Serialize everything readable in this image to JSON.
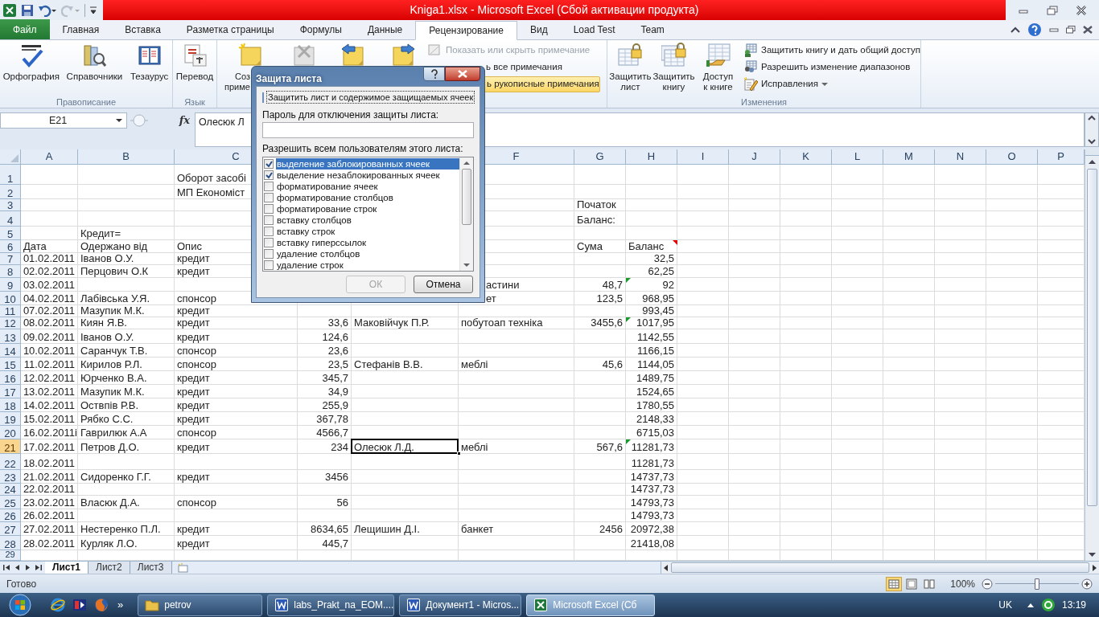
{
  "window": {
    "title": "Kniga1.xlsx  -  Microsoft Excel (Сбой активации продукта)"
  },
  "tabs": [
    {
      "label": "Файл",
      "kind": "file",
      "selected": false
    },
    {
      "label": "Главная",
      "kind": "tab",
      "selected": false
    },
    {
      "label": "Вставка",
      "kind": "tab",
      "selected": false
    },
    {
      "label": "Разметка страницы",
      "kind": "tab",
      "selected": false
    },
    {
      "label": "Формулы",
      "kind": "tab",
      "selected": false
    },
    {
      "label": "Данные",
      "kind": "tab",
      "selected": false
    },
    {
      "label": "Рецензирование",
      "kind": "tab",
      "selected": true
    },
    {
      "label": "Вид",
      "kind": "tab",
      "selected": false
    },
    {
      "label": "Load Test",
      "kind": "tab",
      "selected": false
    },
    {
      "label": "Team",
      "kind": "tab",
      "selected": false
    }
  ],
  "ribbon": {
    "groups": [
      {
        "label": "Правописание",
        "large": [
          {
            "label": "Орфография",
            "kind": "spell"
          },
          {
            "label": "Справочники",
            "kind": "research"
          },
          {
            "label": "Тезаурус",
            "kind": "thesaurus"
          }
        ]
      },
      {
        "label": "Язык",
        "large": [
          {
            "label": "Перевод",
            "kind": "translate"
          }
        ]
      },
      {
        "notes": [
          {
            "label_lines": [
              "Соз",
              "приме"
            ],
            "kind": "new-note"
          },
          {
            "kind": "delete-note"
          },
          {
            "kind": "prev-note"
          },
          {
            "kind": "next-note"
          }
        ],
        "small": [
          {
            "label": "Показать или скрыть примечание",
            "kind": "show-note",
            "disabled": true,
            "highlighted": false
          },
          {
            "label": "ь все примечания",
            "kind": "covered",
            "disabled": false,
            "highlighted": false
          },
          {
            "label": "ь рукописные примечания",
            "kind": "covered",
            "disabled": false,
            "highlighted": true
          }
        ]
      },
      {
        "label": "Изменения",
        "large": [
          {
            "label": "Защитить\nлист",
            "kind": "protect-sheet"
          },
          {
            "label": "Защитить\nкнигу",
            "kind": "protect-book"
          },
          {
            "label": "Доступ\nк книге",
            "kind": "share"
          }
        ],
        "small": [
          {
            "label": "Защитить книгу и дать общий доступ",
            "kind": "share-small",
            "disabled": false,
            "highlighted": false,
            "menu": false
          },
          {
            "label": "Разрешить изменение диапазонов",
            "kind": "ranges",
            "disabled": false,
            "highlighted": false,
            "menu": false
          },
          {
            "label": "Исправления",
            "kind": "track",
            "disabled": false,
            "highlighted": false,
            "menu": true
          }
        ]
      }
    ]
  },
  "formula_bar": {
    "name_box": "E21",
    "function_label": "fx",
    "formula": "Олесюк Л"
  },
  "columns": [
    {
      "label": "A"
    },
    {
      "label": "B"
    },
    {
      "label": "C"
    },
    {
      "label": "F"
    },
    {
      "label": "G"
    },
    {
      "label": "H"
    },
    {
      "label": "I"
    },
    {
      "label": "J"
    },
    {
      "label": "K"
    },
    {
      "label": "L"
    },
    {
      "label": "M"
    },
    {
      "label": "N"
    },
    {
      "label": "O"
    },
    {
      "label": "P"
    }
  ],
  "rows": [
    {
      "header": "1",
      "selected": false,
      "cells": [
        null,
        null,
        {
          "text": "Оборот засобі",
          "kind": "text",
          "selected": false
        },
        null,
        null,
        null,
        null,
        null
      ]
    },
    {
      "header": "2",
      "selected": false,
      "cells": [
        null,
        null,
        {
          "text": "МП Економіст",
          "kind": "text",
          "selected": false
        },
        null,
        null,
        null,
        null,
        null
      ]
    },
    {
      "header": "3",
      "selected": false,
      "cells": [
        null,
        null,
        null,
        null,
        null,
        null,
        {
          "text": "Початок",
          "kind": "text",
          "selected": false
        },
        null
      ]
    },
    {
      "header": "4",
      "selected": false,
      "cells": [
        null,
        null,
        null,
        null,
        null,
        null,
        {
          "text": "Баланс:",
          "kind": "text",
          "selected": false
        },
        null
      ]
    },
    {
      "header": "5",
      "selected": false,
      "cells": [
        null,
        {
          "text": "Кредит=",
          "kind": "text",
          "selected": false
        },
        null,
        null,
        null,
        null,
        null,
        null
      ]
    },
    {
      "header": "6",
      "selected": false,
      "cells": [
        {
          "text": "Дата",
          "kind": "text",
          "selected": false
        },
        {
          "text": "Одержано від",
          "kind": "text",
          "selected": false
        },
        {
          "text": "Опис",
          "kind": "text",
          "selected": false
        },
        null,
        null,
        null,
        {
          "text": "Сума",
          "kind": "text",
          "selected": false
        },
        {
          "text": "Баланс",
          "kind": "text",
          "selected": false,
          "comment": true
        }
      ]
    },
    {
      "header": "7",
      "selected": false,
      "cells": [
        {
          "text": "01.02.2011",
          "kind": "number",
          "selected": false
        },
        {
          "text": "Іванов О.У.",
          "kind": "text",
          "selected": false
        },
        {
          "text": "кредит",
          "kind": "text",
          "selected": false
        },
        null,
        null,
        null,
        null,
        {
          "text": "32,5",
          "kind": "number",
          "selected": false
        }
      ]
    },
    {
      "header": "8",
      "selected": false,
      "cells": [
        {
          "text": "02.02.2011",
          "kind": "number",
          "selected": false
        },
        {
          "text": "Перцович О.К",
          "kind": "text",
          "selected": false
        },
        {
          "text": "кредит",
          "kind": "text",
          "selected": false
        },
        null,
        null,
        null,
        null,
        {
          "text": "62,25",
          "kind": "number",
          "selected": false
        }
      ]
    },
    {
      "header": "9",
      "selected": false,
      "cells": [
        {
          "text": "03.02.2011",
          "kind": "number",
          "selected": false
        },
        null,
        null,
        null,
        null,
        {
          "text": "астини",
          "kind": "covered",
          "selected": false
        },
        {
          "text": "48,7",
          "kind": "number",
          "selected": false
        },
        {
          "text": "92",
          "kind": "number",
          "selected": false,
          "error": true
        }
      ]
    },
    {
      "header": "10",
      "selected": false,
      "cells": [
        {
          "text": "04.02.2011",
          "kind": "number",
          "selected": false
        },
        {
          "text": "Лабівська У.Я.",
          "kind": "text",
          "selected": false
        },
        {
          "text": "спонсор",
          "kind": "text",
          "selected": false
        },
        null,
        null,
        {
          "text": "ет",
          "kind": "covered",
          "selected": false
        },
        {
          "text": "123,5",
          "kind": "number",
          "selected": false
        },
        {
          "text": "968,95",
          "kind": "number",
          "selected": false
        }
      ]
    },
    {
      "header": "11",
      "selected": false,
      "cells": [
        {
          "text": "07.02.2011",
          "kind": "number",
          "selected": false
        },
        {
          "text": "Мазупик М.К.",
          "kind": "text",
          "selected": false
        },
        {
          "text": "кредит",
          "kind": "text",
          "selected": false
        },
        null,
        null,
        null,
        null,
        {
          "text": "993,45",
          "kind": "number",
          "selected": false
        }
      ]
    },
    {
      "header": "12",
      "selected": false,
      "cells": [
        {
          "text": "08.02.2011",
          "kind": "number",
          "selected": false
        },
        {
          "text": "Киян Я.В.",
          "kind": "text",
          "selected": false
        },
        {
          "text": "кредит",
          "kind": "text",
          "selected": false
        },
        {
          "text": "33,6",
          "kind": "number",
          "selected": false
        },
        {
          "text": "Маковійчук П.Р.",
          "kind": "text",
          "selected": false
        },
        {
          "text": "побутоап техніка",
          "kind": "text",
          "selected": false
        },
        {
          "text": "3455,6",
          "kind": "number",
          "selected": false
        },
        {
          "text": "1017,95",
          "kind": "number",
          "selected": false,
          "error": true
        }
      ]
    },
    {
      "header": "13",
      "selected": false,
      "cells": [
        {
          "text": "09.02.2011",
          "kind": "number",
          "selected": false
        },
        {
          "text": "Іванов О.У.",
          "kind": "text",
          "selected": false
        },
        {
          "text": "кредит",
          "kind": "text",
          "selected": false
        },
        {
          "text": "124,6",
          "kind": "number",
          "selected": false
        },
        null,
        null,
        null,
        {
          "text": "1142,55",
          "kind": "number",
          "selected": false
        }
      ]
    },
    {
      "header": "14",
      "selected": false,
      "cells": [
        {
          "text": "10.02.2011",
          "kind": "number",
          "selected": false
        },
        {
          "text": "Саранчук Т.В.",
          "kind": "text",
          "selected": false
        },
        {
          "text": "спонсор",
          "kind": "text",
          "selected": false
        },
        {
          "text": "23,6",
          "kind": "number",
          "selected": false
        },
        null,
        null,
        null,
        {
          "text": "1166,15",
          "kind": "number",
          "selected": false
        }
      ]
    },
    {
      "header": "15",
      "selected": false,
      "cells": [
        {
          "text": "11.02.2011",
          "kind": "number",
          "selected": false
        },
        {
          "text": "Кирилов Р.Л.",
          "kind": "text",
          "selected": false
        },
        {
          "text": "спонсор",
          "kind": "text",
          "selected": false
        },
        {
          "text": "23,5",
          "kind": "number",
          "selected": false
        },
        {
          "text": "Стефанів В.В.",
          "kind": "text",
          "selected": false
        },
        {
          "text": "меблі",
          "kind": "text",
          "selected": false
        },
        {
          "text": "45,6",
          "kind": "number",
          "selected": false
        },
        {
          "text": "1144,05",
          "kind": "number",
          "selected": false
        }
      ]
    },
    {
      "header": "16",
      "selected": false,
      "cells": [
        {
          "text": "12.02.2011",
          "kind": "number",
          "selected": false
        },
        {
          "text": "Юрченко В.А.",
          "kind": "text",
          "selected": false
        },
        {
          "text": "кредит",
          "kind": "text",
          "selected": false
        },
        {
          "text": "345,7",
          "kind": "number",
          "selected": false
        },
        null,
        null,
        null,
        {
          "text": "1489,75",
          "kind": "number",
          "selected": false
        }
      ]
    },
    {
      "header": "17",
      "selected": false,
      "cells": [
        {
          "text": "13.02.2011",
          "kind": "number",
          "selected": false
        },
        {
          "text": "Мазупик М.К.",
          "kind": "text",
          "selected": false
        },
        {
          "text": "кредит",
          "kind": "text",
          "selected": false
        },
        {
          "text": "34,9",
          "kind": "number",
          "selected": false
        },
        null,
        null,
        null,
        {
          "text": "1524,65",
          "kind": "number",
          "selected": false
        }
      ]
    },
    {
      "header": "18",
      "selected": false,
      "cells": [
        {
          "text": "14.02.2011",
          "kind": "number",
          "selected": false
        },
        {
          "text": "Оствпів Р.В.",
          "kind": "text",
          "selected": false
        },
        {
          "text": "кредит",
          "kind": "text",
          "selected": false
        },
        {
          "text": "255,9",
          "kind": "number",
          "selected": false
        },
        null,
        null,
        null,
        {
          "text": "1780,55",
          "kind": "number",
          "selected": false
        }
      ]
    },
    {
      "header": "19",
      "selected": false,
      "cells": [
        {
          "text": "15.02.2011",
          "kind": "number",
          "selected": false
        },
        {
          "text": "Рябко С.С.",
          "kind": "text",
          "selected": false
        },
        {
          "text": "кредит",
          "kind": "text",
          "selected": false
        },
        {
          "text": "367,78",
          "kind": "number",
          "selected": false
        },
        null,
        null,
        null,
        {
          "text": "2148,33",
          "kind": "number",
          "selected": false
        }
      ]
    },
    {
      "header": "20",
      "selected": false,
      "cells": [
        {
          "text": "16.02.2011і",
          "kind": "text",
          "selected": false
        },
        {
          "text": "Гаврилюк А.А",
          "kind": "text",
          "selected": false
        },
        {
          "text": "спонсор",
          "kind": "text",
          "selected": false
        },
        {
          "text": "4566,7",
          "kind": "number",
          "selected": false
        },
        null,
        null,
        null,
        {
          "text": "6715,03",
          "kind": "number",
          "selected": false
        }
      ]
    },
    {
      "header": "21",
      "selected": true,
      "cells": [
        {
          "text": "17.02.2011",
          "kind": "number",
          "selected": false
        },
        {
          "text": "Петров Д.О.",
          "kind": "text",
          "selected": false
        },
        {
          "text": "кредит",
          "kind": "text",
          "selected": false
        },
        {
          "text": "234",
          "kind": "number",
          "selected": false
        },
        {
          "text": "Олесюк Л.Д.",
          "kind": "text",
          "selected": true
        },
        {
          "text": "меблі",
          "kind": "text",
          "selected": false
        },
        {
          "text": "567,6",
          "kind": "number",
          "selected": false
        },
        {
          "text": "11281,73",
          "kind": "number",
          "selected": false,
          "error": true
        }
      ]
    },
    {
      "header": "22",
      "selected": false,
      "cells": [
        {
          "text": "18.02.2011",
          "kind": "number",
          "selected": false
        },
        null,
        null,
        null,
        null,
        null,
        null,
        {
          "text": "11281,73",
          "kind": "number",
          "selected": false
        }
      ]
    },
    {
      "header": "23",
      "selected": false,
      "cells": [
        {
          "text": "21.02.2011",
          "kind": "number",
          "selected": false
        },
        {
          "text": "Сидоренко Г.Г.",
          "kind": "text",
          "selected": false
        },
        {
          "text": "кредит",
          "kind": "text",
          "selected": false
        },
        {
          "text": "3456",
          "kind": "number",
          "selected": false
        },
        null,
        null,
        null,
        {
          "text": "14737,73",
          "kind": "number",
          "selected": false
        }
      ]
    },
    {
      "header": "24",
      "selected": false,
      "cells": [
        {
          "text": "22.02.2011",
          "kind": "number",
          "selected": false
        },
        null,
        null,
        null,
        null,
        null,
        null,
        {
          "text": "14737,73",
          "kind": "number",
          "selected": false
        }
      ]
    },
    {
      "header": "25",
      "selected": false,
      "cells": [
        {
          "text": "23.02.2011",
          "kind": "number",
          "selected": false
        },
        {
          "text": "Власюк Д.А.",
          "kind": "text",
          "selected": false
        },
        {
          "text": "спонсор",
          "kind": "text",
          "selected": false
        },
        {
          "text": "56",
          "kind": "number",
          "selected": false
        },
        null,
        null,
        null,
        {
          "text": "14793,73",
          "kind": "number",
          "selected": false
        }
      ]
    },
    {
      "header": "26",
      "selected": false,
      "cells": [
        {
          "text": "26.02.2011",
          "kind": "number",
          "selected": false
        },
        null,
        null,
        null,
        null,
        null,
        null,
        {
          "text": "14793,73",
          "kind": "number",
          "selected": false
        }
      ]
    },
    {
      "header": "27",
      "selected": false,
      "cells": [
        {
          "text": "27.02.2011",
          "kind": "number",
          "selected": false
        },
        {
          "text": "Нестеренко П.Л.",
          "kind": "text",
          "selected": false
        },
        {
          "text": "кредит",
          "kind": "text",
          "selected": false
        },
        {
          "text": "8634,65",
          "kind": "number",
          "selected": false
        },
        {
          "text": "Лещишин Д.І.",
          "kind": "text",
          "selected": false
        },
        {
          "text": "банкет",
          "kind": "text",
          "selected": false
        },
        {
          "text": "2456",
          "kind": "number",
          "selected": false
        },
        {
          "text": "20972,38",
          "kind": "number",
          "selected": false
        }
      ]
    },
    {
      "header": "28",
      "selected": false,
      "cells": [
        {
          "text": "28.02.2011",
          "kind": "number",
          "selected": false
        },
        {
          "text": "Курляк Л.О.",
          "kind": "text",
          "selected": false
        },
        {
          "text": "кредит",
          "kind": "text",
          "selected": false
        },
        {
          "text": "445,7",
          "kind": "number",
          "selected": false
        },
        null,
        null,
        null,
        {
          "text": "21418,08",
          "kind": "number",
          "selected": false
        }
      ]
    },
    {
      "header": "29",
      "selected": false,
      "cells": [
        null,
        null,
        null,
        null,
        null,
        null,
        null,
        null
      ]
    }
  ],
  "sheet_tabs": [
    {
      "label": "Лист1",
      "selected": true
    },
    {
      "label": "Лист2",
      "selected": false
    },
    {
      "label": "Лист3",
      "selected": false
    }
  ],
  "status_bar": {
    "text": "Готово",
    "views": [
      {
        "kind": "normal",
        "selected": true
      },
      {
        "kind": "layout",
        "selected": false
      },
      {
        "kind": "page-break",
        "selected": false
      }
    ],
    "zoom": "100%",
    "zoom_slider": {
      "level": 0.5
    }
  },
  "dialog": {
    "title": "Защита листа",
    "protect": {
      "label": "Защитить лист и содержимое защищаемых ячеек",
      "checked": false
    },
    "password_label": "Пароль для отключения защиты листа:",
    "allow_label": "Разрешить всем пользователям этого листа:",
    "permissions": [
      {
        "label": "выделение заблокированных ячеек",
        "checked": true,
        "selected": true
      },
      {
        "label": "выделение незаблокированных ячеек",
        "checked": true,
        "selected": false
      },
      {
        "label": "форматирование ячеек",
        "checked": false,
        "selected": false
      },
      {
        "label": "форматирование столбцов",
        "checked": false,
        "selected": false
      },
      {
        "label": "форматирование строк",
        "checked": false,
        "selected": false
      },
      {
        "label": "вставку столбцов",
        "checked": false,
        "selected": false
      },
      {
        "label": "вставку строк",
        "checked": false,
        "selected": false
      },
      {
        "label": "вставку гиперссылок",
        "checked": false,
        "selected": false
      },
      {
        "label": "удаление столбцов",
        "checked": false,
        "selected": false
      },
      {
        "label": "удаление строк",
        "checked": false,
        "selected": false
      }
    ],
    "buttons": [
      {
        "label": "ОК",
        "disabled": true
      },
      {
        "label": "Отмена",
        "disabled": false
      }
    ]
  },
  "taskbar": {
    "overflow": "»",
    "items": [
      {
        "label": "petrov",
        "kind": "folder",
        "selected": false
      },
      {
        "label": "labs_Prakt_na_EOM....",
        "kind": "word",
        "selected": false
      },
      {
        "label": "Документ1 - Micros...",
        "kind": "word",
        "selected": false
      },
      {
        "label": "Microsoft Excel (Сб",
        "kind": "excel",
        "selected": true
      }
    ],
    "language": "UK",
    "clock": "13:19"
  }
}
